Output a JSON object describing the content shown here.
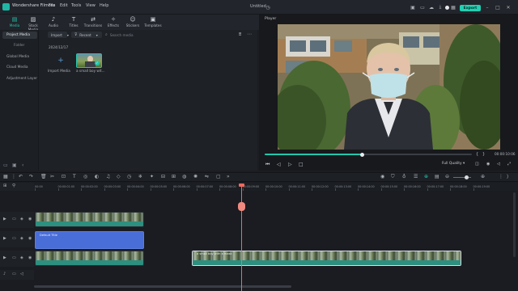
{
  "app": {
    "name": "Wondershare Filmora",
    "menus": [
      "File",
      "Edit",
      "Tools",
      "View",
      "Help"
    ],
    "doc_title": "Untitled",
    "export_label": "Export"
  },
  "toolbar_tabs": [
    {
      "label": "Media",
      "icon": "media-icon"
    },
    {
      "label": "Stock Media",
      "icon": "stock-media-icon"
    },
    {
      "label": "Audio",
      "icon": "audio-icon"
    },
    {
      "label": "Titles",
      "icon": "titles-icon"
    },
    {
      "label": "Transitions",
      "icon": "transitions-icon"
    },
    {
      "label": "Effects",
      "icon": "effects-icon"
    },
    {
      "label": "Stickers",
      "icon": "stickers-icon"
    },
    {
      "label": "Templates",
      "icon": "templates-icon"
    }
  ],
  "sidebar": {
    "items": [
      "Project Media",
      "Folder",
      "Global Media",
      "Cloud Media",
      "Adjustment Layer"
    ]
  },
  "media": {
    "import_filter": "Import",
    "sort": "Recent",
    "search_placeholder": "Search media",
    "date": "2024/12/17",
    "import_label": "Import Media",
    "clip_label": "a small boy wit..."
  },
  "player": {
    "title": "Player",
    "progress": 0.47,
    "timecode": "00:00:10:06",
    "quality": "Full Quality"
  },
  "timeline": {
    "ruler": [
      "00:00",
      "00:00:01:00",
      "00:00:02:00",
      "00:00:03:00",
      "00:00:04:00",
      "00:00:05:00",
      "00:00:06:00",
      "00:00:07:00",
      "00:00:08:00",
      "00:00:09:00",
      "00:00:10:00",
      "00:00:11:00",
      "00:00:12:00",
      "00:00:13:00",
      "00:00:14:00",
      "00:00:15:00",
      "00:00:16:00",
      "00:00:17:00",
      "00:00:18:00",
      "00:00:19:00"
    ],
    "title_clip": "Default Title",
    "video_clip": "a small boy with a mask"
  },
  "colors": {
    "accent": "#22c6ad",
    "playhead": "#f06a5e",
    "title_clip": "#4a6ed8"
  }
}
